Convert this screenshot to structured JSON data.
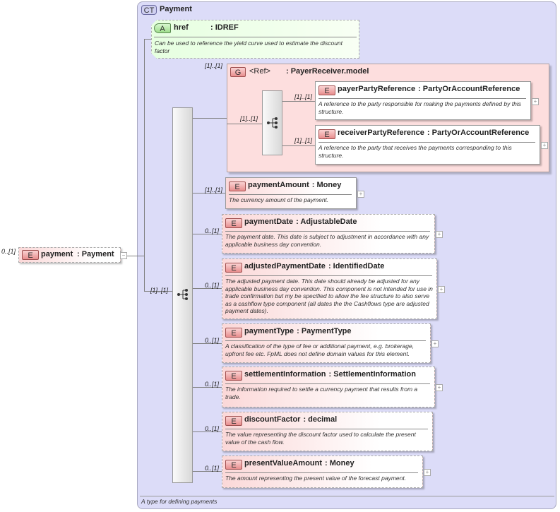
{
  "complex_type": {
    "badge": "CT",
    "name": "Payment",
    "description": "A type for defining payments"
  },
  "attribute": {
    "badge": "A",
    "name": "href",
    "type": ": IDREF",
    "description": "Can be used to reference the yield curve used to estimate the discount factor"
  },
  "root_element": {
    "badge": "E",
    "name": "payment",
    "type": ": Payment",
    "cardinality": "0..[1]",
    "toggle": "−"
  },
  "sequence_cardinality": "[1]..[1]",
  "group": {
    "badge": "G",
    "name": "<Ref>",
    "type": ": PayerReceiver.model",
    "cardinality": "[1]..[1]",
    "sequence_cardinality": "[1]..[1]",
    "elements": [
      {
        "badge": "E",
        "name": "payerPartyReference",
        "type": ": PartyOrAccountReference",
        "cardinality": "[1]..[1]",
        "description": "A reference to the party responsible for making the payments defined by this structure.",
        "toggle": "+"
      },
      {
        "badge": "E",
        "name": "receiverPartyReference",
        "type": ": PartyOrAccountReference",
        "cardinality": "[1]..[1]",
        "description": "A reference to the party that receives the payments corresponding to this structure.",
        "toggle": "+"
      }
    ]
  },
  "elements": [
    {
      "badge": "E",
      "name": "paymentAmount",
      "type": ": Money",
      "cardinality": "[1]..[1]",
      "description": "The currency amount of the payment.",
      "toggle": "+"
    },
    {
      "badge": "E",
      "name": "paymentDate",
      "type": ": AdjustableDate",
      "cardinality": "0..[1]",
      "description": "The payment date. This date is subject to adjustment in accordance with any applicable business day convention.",
      "toggle": "+"
    },
    {
      "badge": "E",
      "name": "adjustedPaymentDate",
      "type": ": IdentifiedDate",
      "cardinality": "0..[1]",
      "description": "The adjusted payment date. This date should already be adjusted for any applicable business day convention. This component is not intended for use in trade confirmation but my be specified to allow the fee structure to also serve as a cashflow type component (all dates the the Cashflows type are adjusted payment dates).",
      "toggle": "+"
    },
    {
      "badge": "E",
      "name": "paymentType",
      "type": ": PaymentType",
      "cardinality": "0..[1]",
      "description": "A classification of the type of fee or additional payment, e.g. brokerage, upfront fee etc. FpML does not define domain values for this element.",
      "toggle": "+"
    },
    {
      "badge": "E",
      "name": "settlementInformation",
      "type": ": SettlementInformation",
      "cardinality": "0..[1]",
      "description": "The information required to settle a currency payment that results from a trade.",
      "toggle": "+"
    },
    {
      "badge": "E",
      "name": "discountFactor",
      "type": ": decimal",
      "cardinality": "0..[1]",
      "description": "The value representing the discount factor used to calculate the present value of the cash flow.",
      "toggle": ""
    },
    {
      "badge": "E",
      "name": "presentValueAmount",
      "type": ": Money",
      "cardinality": "0..[1]",
      "description": "The amount representing the present value of the forecast payment.",
      "toggle": "+"
    }
  ]
}
